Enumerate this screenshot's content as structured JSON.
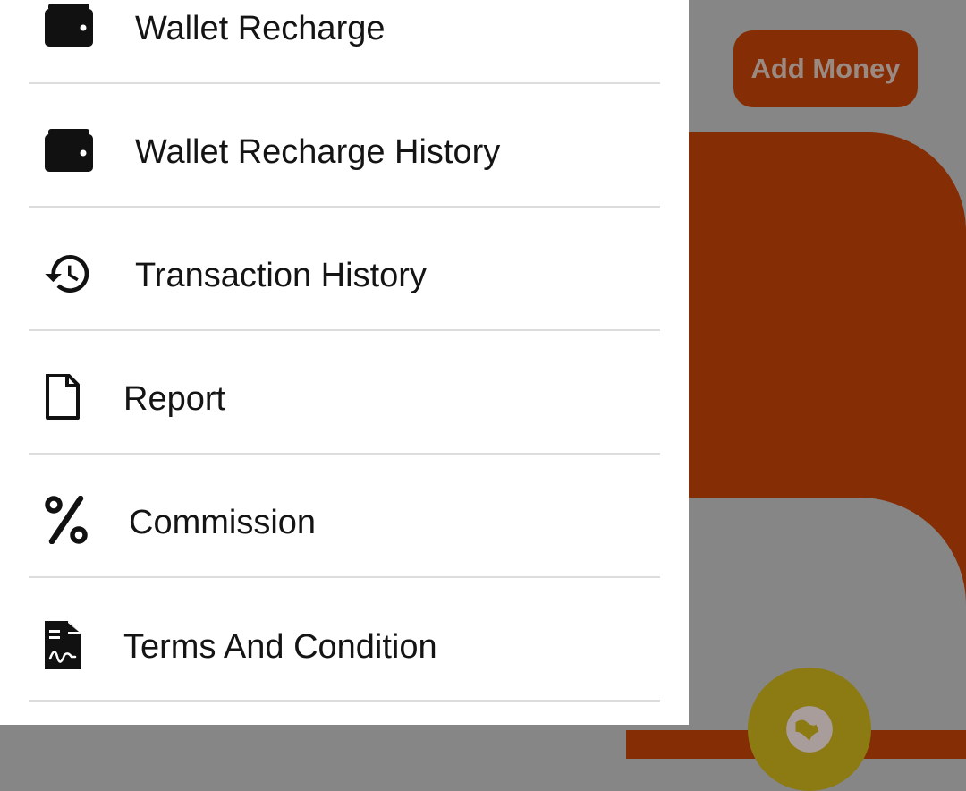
{
  "background": {
    "add_money_label": "Add Money",
    "accent_color": "#852d05",
    "fab_icon": "globe-icon"
  },
  "drawer": {
    "items": [
      {
        "label": "Wallet Recharge",
        "icon": "wallet-icon"
      },
      {
        "label": "Wallet Recharge History",
        "icon": "wallet-icon"
      },
      {
        "label": "Transaction History",
        "icon": "history-icon"
      },
      {
        "label": "Report",
        "icon": "document-icon"
      },
      {
        "label": "Commission",
        "icon": "percent-icon"
      },
      {
        "label": "Terms And Condition",
        "icon": "receipt-icon"
      }
    ]
  }
}
